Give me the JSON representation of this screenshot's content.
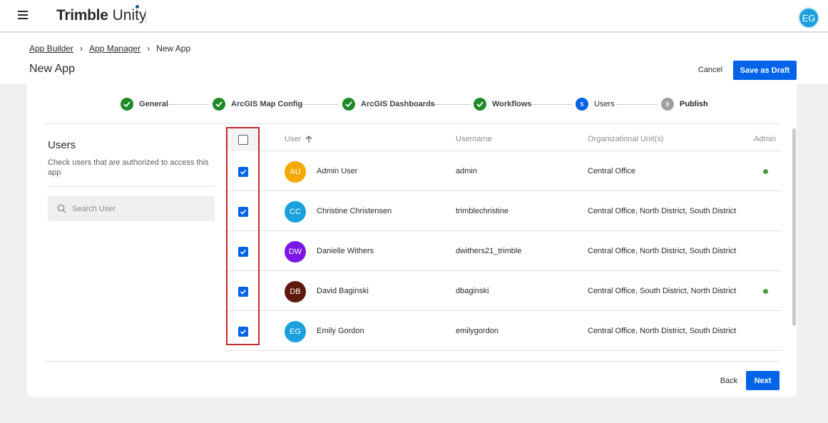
{
  "app": {
    "brand": "Trimble",
    "product": "Unity",
    "user_initials": "EG"
  },
  "breadcrumb": [
    {
      "label": "App Builder"
    },
    {
      "label": "App Manager"
    },
    {
      "label": "New App"
    }
  ],
  "page_title": "New App",
  "header_actions": {
    "cancel_label": "Cancel",
    "save_draft_label": "Save as Draft"
  },
  "stepper": [
    {
      "label": "General",
      "state": "done",
      "number": ""
    },
    {
      "label": "ArcGIS Map Config",
      "state": "done",
      "number": ""
    },
    {
      "label": "ArcGIS Dashboards",
      "state": "done",
      "number": ""
    },
    {
      "label": "Workflows",
      "state": "done",
      "number": ""
    },
    {
      "label": "Users",
      "state": "active",
      "number": "5"
    },
    {
      "label": "Publish",
      "state": "pending",
      "number": "6"
    }
  ],
  "users_panel": {
    "title": "Users",
    "description": "Check users that are authorized to access this app",
    "search_placeholder": "Search User"
  },
  "table": {
    "columns": {
      "user": "User",
      "username": "Username",
      "org_units": "Organizational Unit(s)",
      "admin": "Admin"
    },
    "select_all_checked": false,
    "rows": [
      {
        "initials": "AU",
        "avatar_color": "#f5a800",
        "name": "Admin User",
        "username": "admin",
        "org_units": "Central Office",
        "admin": true,
        "checked": true
      },
      {
        "initials": "CC",
        "avatar_color": "#1aa0dc",
        "name": "Christine Christensen",
        "username": "trimblechristine",
        "org_units": "Central Office, North District, South District",
        "admin": false,
        "checked": true
      },
      {
        "initials": "DW",
        "avatar_color": "#7a17e6",
        "name": "Danielle Withers",
        "username": "dwithers21_trimble",
        "org_units": "Central Office, North District, South District",
        "admin": false,
        "checked": true
      },
      {
        "initials": "DB",
        "avatar_color": "#5e1a0c",
        "name": "David Baginski",
        "username": "dbaginski",
        "org_units": "Central Office, South District, North District",
        "admin": true,
        "checked": true
      },
      {
        "initials": "EG",
        "avatar_color": "#1aa0dc",
        "name": "Emily Gordon",
        "username": "emilygordon",
        "org_units": "Central Office, North District, South District",
        "admin": false,
        "checked": true
      }
    ]
  },
  "footer_actions": {
    "back_label": "Back",
    "next_label": "Next"
  },
  "colors": {
    "primary": "#0063e8",
    "step_done": "#1e8a28",
    "admin_dot": "#4a9a3b",
    "highlight": "#c62828"
  }
}
